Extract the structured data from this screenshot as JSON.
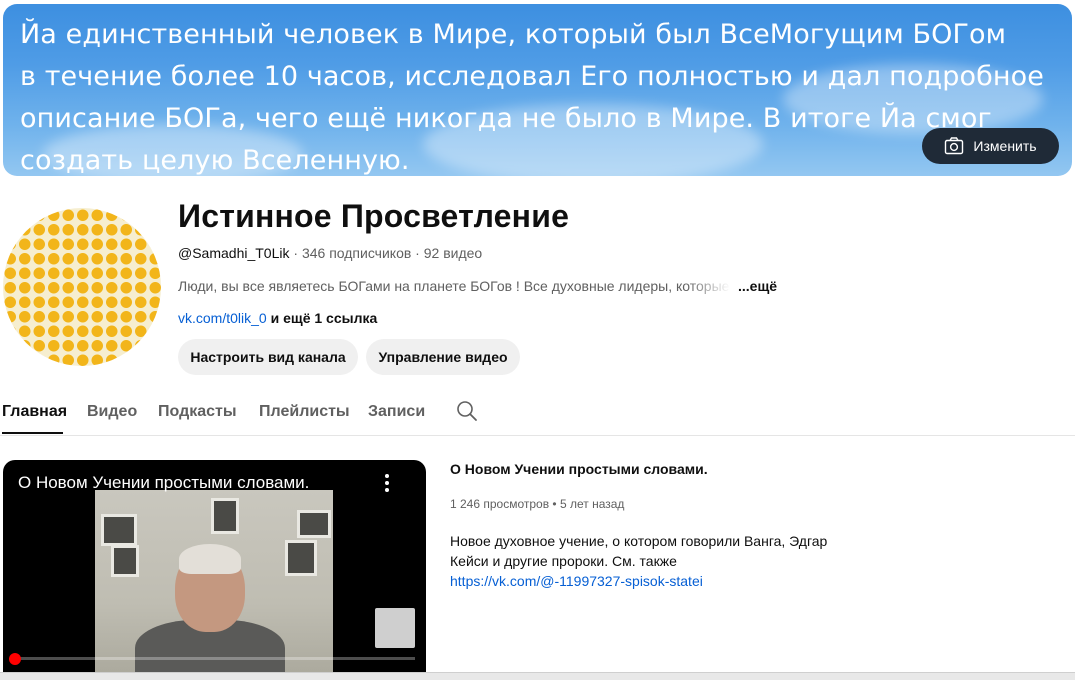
{
  "banner": {
    "text": "Йа единственный человек в Мире, который был ВсеМогущим БОГом\nв течение более 10 часов, исследовал Его полностью и дал подробное\nописание БОГа, чего ещё никогда не было в Мире. В итоге Йа смог\nсоздать целую Вселенную.",
    "change_label": "Изменить"
  },
  "channel": {
    "title": "Истинное Просветление",
    "handle": "@Samadhi_T0Lik",
    "subscribers": "346 подписчиков",
    "videos": "92 видео",
    "separator": " · ",
    "description": "Люди, вы все являетесь БОГами на планете БОГов ! Все духовные лидеры, которые",
    "more_label": "...ещё",
    "link": "vk.com/t0lik_0",
    "more_links": "и ещё 1 ссылка",
    "customize_label": "Настроить вид канала",
    "manage_label": "Управление видео"
  },
  "tabs": [
    {
      "label": "Главная"
    },
    {
      "label": "Видео"
    },
    {
      "label": "Подкасты"
    },
    {
      "label": "Плейлисты"
    },
    {
      "label": "Записи"
    }
  ],
  "featured": {
    "player_title": "О Новом Учении простыми словами.",
    "title": "О Новом Учении простыми словами.",
    "views": "1 246 просмотров",
    "age": "5 лет назад",
    "meta_separator": " • ",
    "desc_line1": "Новое духовное учение, о котором говорили Ванга, Эдгар",
    "desc_line2": "Кейси и другие пророки. См. также",
    "desc_link": "https://vk.com/@-11997327-spisok-statei"
  },
  "colors": {
    "link": "#065fd4",
    "progress": "#ff0000",
    "change_button_bg": "#1f2a37"
  }
}
